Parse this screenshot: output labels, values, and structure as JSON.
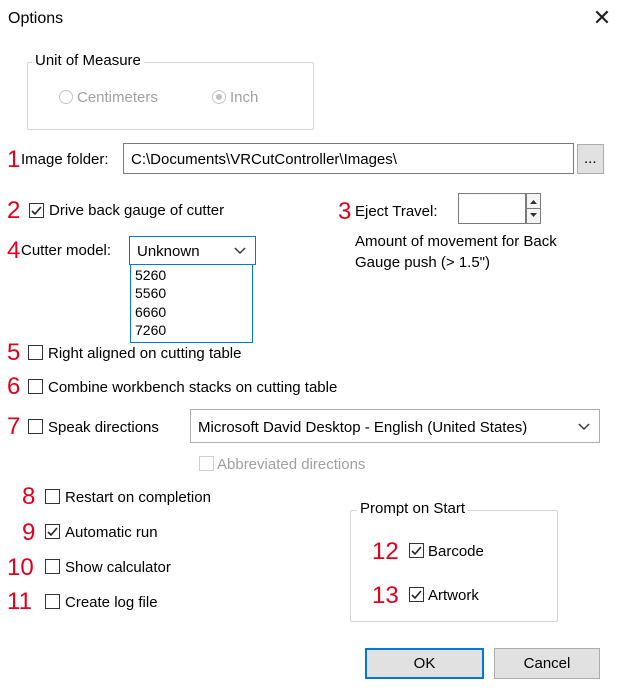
{
  "window": {
    "title": "Options",
    "close_glyph": "✕"
  },
  "unit_of_measure": {
    "label": "Unit of Measure",
    "options": [
      {
        "label": "Centimeters",
        "selected": false
      },
      {
        "label": "Inch",
        "selected": true
      }
    ]
  },
  "image_folder": {
    "number": "1",
    "label": "Image folder:",
    "value": "C:\\Documents\\VRCutController\\Images\\",
    "browse_label": "..."
  },
  "drive_back_gauge": {
    "number": "2",
    "label": "Drive back gauge of cutter",
    "checked": true
  },
  "eject_travel": {
    "number": "3",
    "label": "Eject Travel:",
    "value": "",
    "help_line1": "Amount of movement for Back",
    "help_line2": "Gauge push (> 1.5\")"
  },
  "cutter_model": {
    "number": "4",
    "label": "Cutter model:",
    "selected": "Unknown",
    "options": [
      "5260",
      "5560",
      "6660",
      "7260"
    ]
  },
  "right_aligned": {
    "number": "5",
    "label": "Right aligned on cutting table",
    "checked": false
  },
  "combine_stacks": {
    "number": "6",
    "label": "Combine workbench stacks on cutting table",
    "checked": false
  },
  "speak_directions": {
    "number": "7",
    "label": "Speak directions",
    "checked": false,
    "voice": "Microsoft David Desktop - English (United States)"
  },
  "abbreviated_directions": {
    "label": "Abbreviated directions",
    "checked": false
  },
  "restart_on_completion": {
    "number": "8",
    "label": "Restart on completion",
    "checked": false
  },
  "automatic_run": {
    "number": "9",
    "label": "Automatic run",
    "checked": true
  },
  "show_calculator": {
    "number": "10",
    "label": "Show calculator",
    "checked": false
  },
  "create_log_file": {
    "number": "11",
    "label": "Create log file",
    "checked": false
  },
  "prompt_on_start": {
    "label": "Prompt on Start",
    "barcode": {
      "number": "12",
      "label": "Barcode",
      "checked": true
    },
    "artwork": {
      "number": "13",
      "label": "Artwork",
      "checked": true
    }
  },
  "buttons": {
    "ok": "OK",
    "cancel": "Cancel"
  }
}
